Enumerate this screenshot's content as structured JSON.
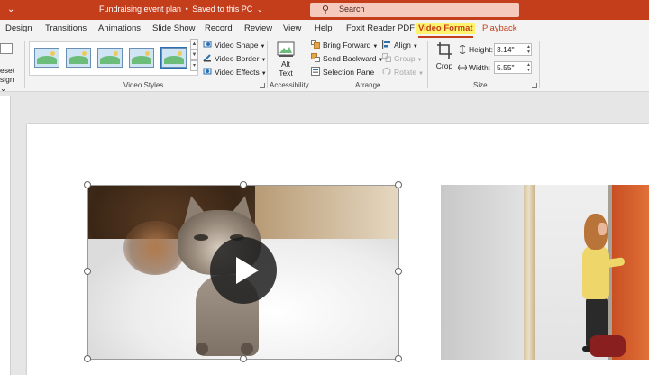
{
  "titlebar": {
    "doc_title": "Fundraising event plan",
    "separator": "•",
    "save_state": "Saved to this PC",
    "caret": "⌄",
    "search_placeholder": "Search",
    "color": "#c43e1c"
  },
  "tabs": [
    {
      "label": "Design"
    },
    {
      "label": "Transitions"
    },
    {
      "label": "Animations"
    },
    {
      "label": "Slide Show"
    },
    {
      "label": "Record"
    },
    {
      "label": "Review"
    },
    {
      "label": "View"
    },
    {
      "label": "Help"
    },
    {
      "label": "Foxit Reader PDF"
    },
    {
      "label": "Video Format",
      "active": true
    },
    {
      "label": "Playback"
    }
  ],
  "ribbon": {
    "reset": {
      "line1": "eset",
      "line2": "sign ⌄"
    },
    "video_styles": {
      "label": "Video Styles",
      "commands": {
        "video_shape": "Video Shape",
        "video_border": "Video Border",
        "video_effects": "Video Effects"
      }
    },
    "accessibility": {
      "label": "Accessibility",
      "alt_text_line1": "Alt",
      "alt_text_line2": "Text"
    },
    "arrange": {
      "label": "Arrange",
      "bring_forward": "Bring Forward",
      "send_backward": "Send Backward",
      "selection_pane": "Selection Pane",
      "align": "Align",
      "group": "Group",
      "rotate": "Rotate"
    },
    "size": {
      "label": "Size",
      "crop": "Crop",
      "height_label": "Height:",
      "height_value": "3.14\"",
      "width_label": "Width:",
      "width_value": "5.55\""
    }
  },
  "colors": {
    "accent": "#c43e1c",
    "highlight": "#fff36b",
    "ribbon_bg": "#f3f3f3",
    "canvas_bg": "#e6e6e6"
  }
}
